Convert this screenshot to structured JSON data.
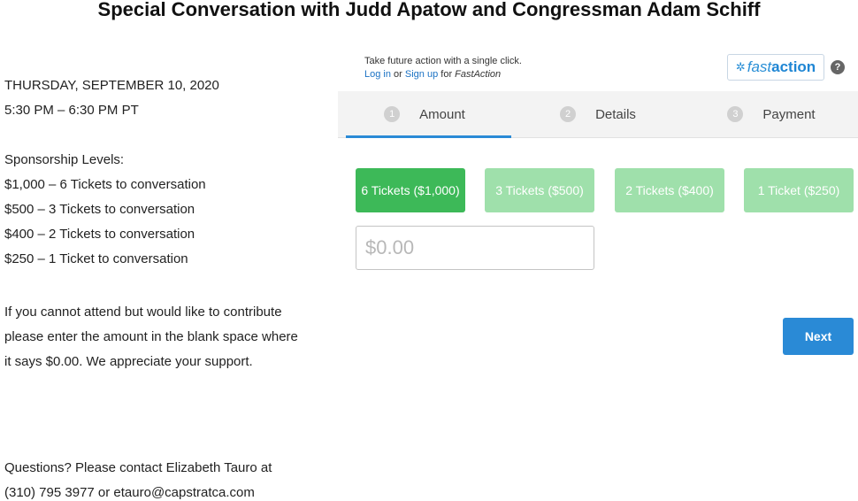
{
  "page_title": "Special Conversation with Judd Apatow and Congressman Adam Schiff",
  "event": {
    "date": "THURSDAY, SEPTEMBER 10, 2020",
    "time": "5:30 PM – 6:30 PM PT"
  },
  "sponsorship": {
    "heading": "Sponsorship Levels:",
    "levels": [
      "$1,000 – 6 Tickets to conversation",
      "$500 – 3 Tickets to conversation",
      "$400 – 2 Tickets to conversation",
      "$250 – 1 Ticket to conversation"
    ]
  },
  "contribute_note": [
    "If you cannot attend but would like to contribute",
    "please enter the amount in the blank space where",
    "it says $0.00. We appreciate your support."
  ],
  "contact": [
    "Questions? Please contact Elizabeth Tauro at",
    "(310) 795 3977 or etauro@capstratca.com"
  ],
  "fastaction": {
    "prompt": "Take future action with a single click.",
    "login_label": "Log in",
    "or_text": "or",
    "signup_label": "Sign up",
    "for_text": "for",
    "brand_italic": "FastAction",
    "logo_fast": "fast",
    "logo_action": "action",
    "help_glyph": "?",
    "accent_color": "#2a8fd6"
  },
  "steps": [
    {
      "num": "1",
      "label": "Amount",
      "active": true
    },
    {
      "num": "2",
      "label": "Details",
      "active": false
    },
    {
      "num": "3",
      "label": "Payment",
      "active": false
    }
  ],
  "tickets": [
    {
      "label": "6 Tickets ($1,000)",
      "selected": true
    },
    {
      "label": "3 Tickets ($500)",
      "selected": false
    },
    {
      "label": "2 Tickets ($400)",
      "selected": false
    },
    {
      "label": "1 Ticket ($250)",
      "selected": false
    }
  ],
  "amount_input": {
    "placeholder": "$0.00",
    "value": ""
  },
  "next_label": "Next",
  "colors": {
    "selected_green": "#3db958",
    "unselected_green": "#9fe0ab",
    "primary_blue": "#2a8ad6"
  }
}
